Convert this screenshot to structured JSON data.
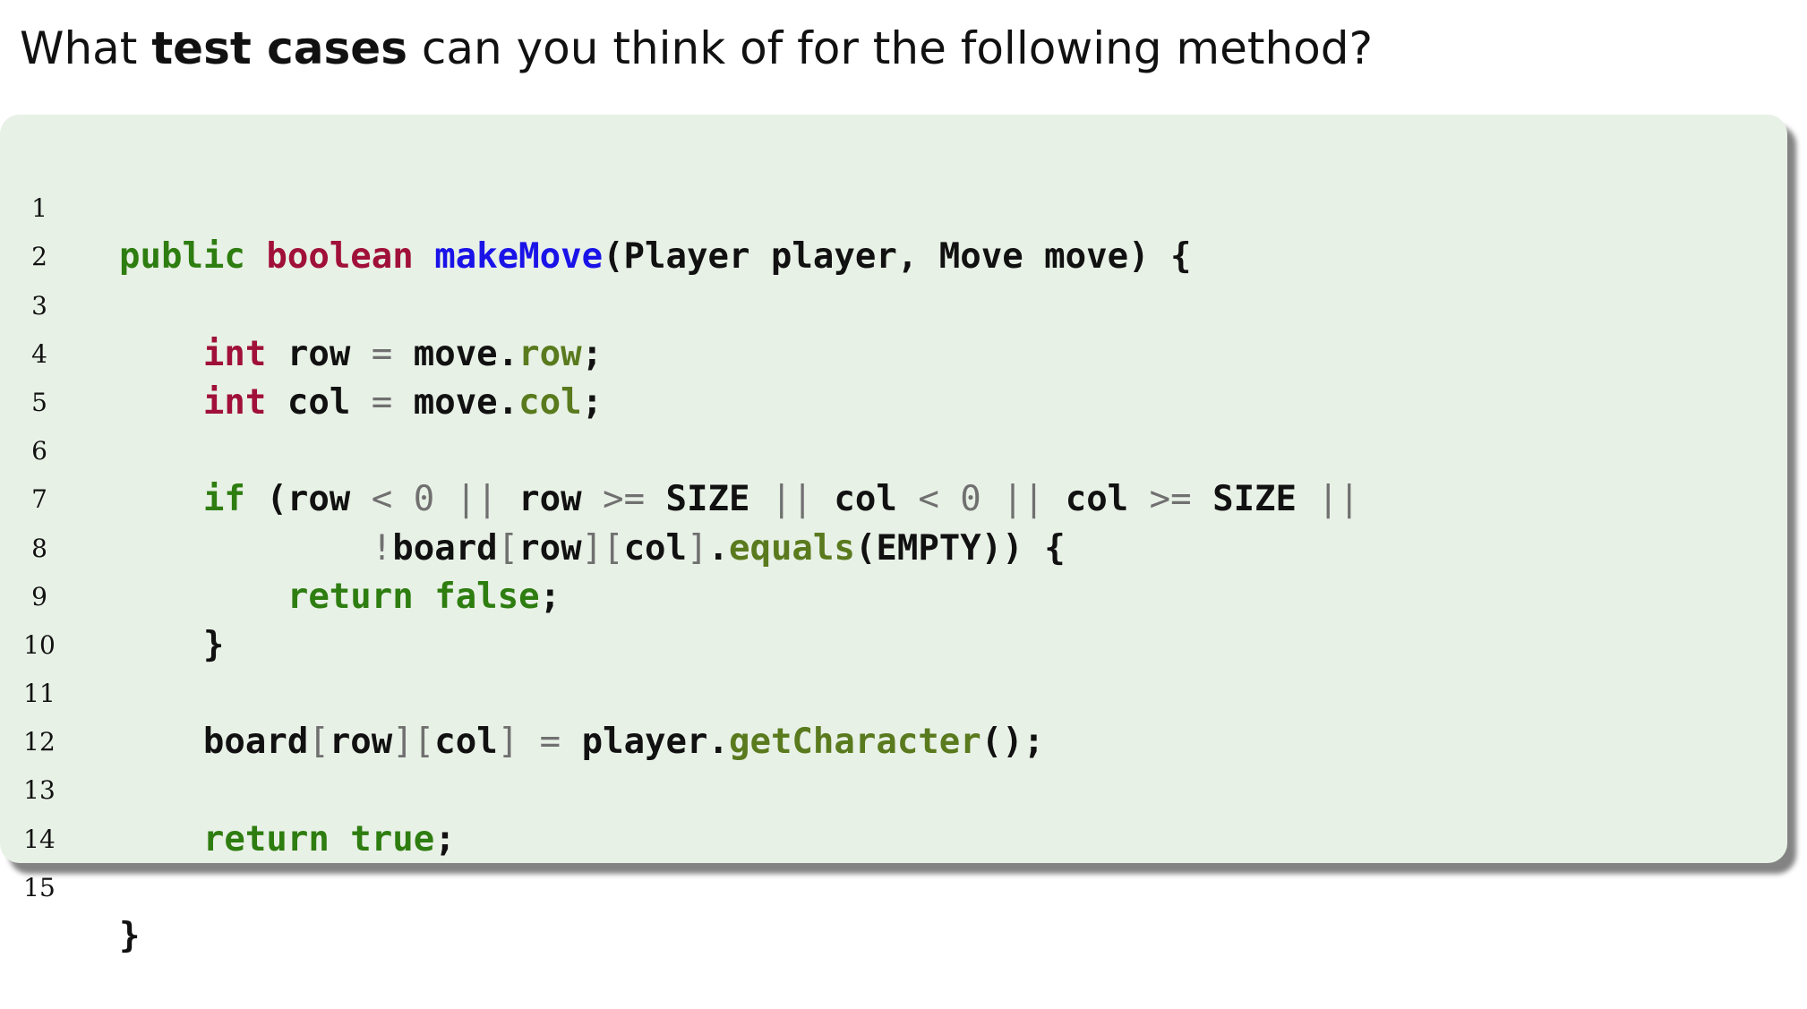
{
  "question": {
    "prefix": "What ",
    "bold": "test cases",
    "suffix": " can you think of for the following method?"
  },
  "code": {
    "line_numbers": [
      "1",
      "2",
      "3",
      "4",
      "5",
      "6",
      "7",
      "8",
      "9",
      "10",
      "11",
      "12",
      "13",
      "14",
      "15"
    ],
    "l1": {
      "public": "public",
      "boolean": "boolean",
      "name": "makeMove",
      "rest": "(Player player, Move move) {"
    },
    "l3": {
      "indent": "    ",
      "type": "int",
      "a": " row ",
      "eq": "=",
      "b": " move.",
      "member": "row",
      "end": ";"
    },
    "l4": {
      "indent": "    ",
      "type": "int",
      "a": " col ",
      "eq": "=",
      "b": " move.",
      "member": "col",
      "end": ";"
    },
    "l6": {
      "indent": "    ",
      "if": "if",
      "p0": " (row ",
      "lt1": "<",
      "sp1": " ",
      "n1": "0",
      "sp2": " ",
      "or1": "||",
      "p1": " row ",
      "ge1": ">=",
      "p2": " SIZE ",
      "or2": "||",
      "p3": " col ",
      "lt2": "<",
      "sp3": " ",
      "n2": "0",
      "sp4": " ",
      "or3": "||",
      "p4": " col ",
      "ge2": ">=",
      "p5": " SIZE ",
      "or4": "||"
    },
    "l7": {
      "indent": "            ",
      "not": "!",
      "board": "board",
      "lb1": "[",
      "row": "row",
      "rb1": "]",
      "lb2": "[",
      "col": "col",
      "rb2": "]",
      "dot": ".",
      "member": "equals",
      "rest": "(EMPTY)) {"
    },
    "l8": {
      "indent": "        ",
      "ret": "return",
      "sp": " ",
      "val": "false",
      "end": ";"
    },
    "l9": {
      "indent": "    ",
      "text": "}"
    },
    "l11": {
      "indent": "    ",
      "board": "board",
      "lb1": "[",
      "row": "row",
      "rb1": "]",
      "lb2": "[",
      "col": "col",
      "rb2": "]",
      "sp1": " ",
      "eq": "=",
      "b": " player.",
      "member": "getCharacter",
      "end": "();"
    },
    "l13": {
      "indent": "    ",
      "ret": "return",
      "sp": " ",
      "val": "true",
      "end": ";"
    },
    "l15": {
      "text": "}"
    }
  },
  "colors": {
    "box_background": "#e8f1e6",
    "keyword_green": "#2e7d10",
    "type_red": "#a0103a",
    "function_blue": "#1a13e8",
    "member_olive": "#5a7a1e",
    "operator_gray": "#707070"
  }
}
